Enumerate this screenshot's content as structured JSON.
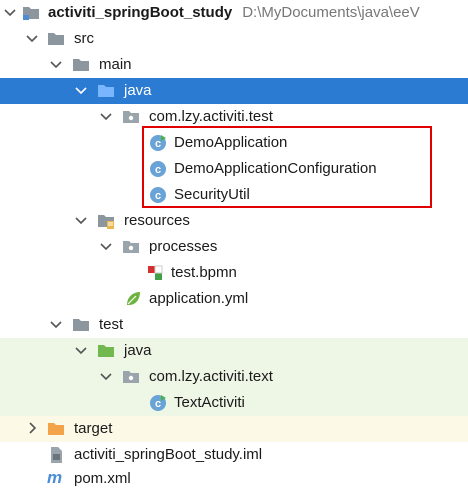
{
  "tree": {
    "root": {
      "name": "activiti_springBoot_study",
      "path": "D:\\MyDocuments\\java\\eeV"
    },
    "src": "src",
    "main": "main",
    "main_java": "java",
    "main_pkg": "com.lzy.activiti.test",
    "demo_app": "DemoApplication",
    "demo_config": "DemoApplicationConfiguration",
    "security_util": "SecurityUtil",
    "resources": "resources",
    "processes": "processes",
    "bpmn": "test.bpmn",
    "app_yml": "application.yml",
    "test": "test",
    "test_java": "java",
    "test_pkg": "com.lzy.activiti.text",
    "text_activiti": "TextActiviti",
    "target": "target",
    "iml": "activiti_springBoot_study.iml",
    "pom": "pom.xml"
  },
  "colors": {
    "selection": "#2b7bd2",
    "folder": "#8c969e",
    "source_folder": "#4b8ed6",
    "test_folder": "#71b94f",
    "target_folder": "#f3a34a",
    "class_icon": "#6aa3d6",
    "highlight_box": "#e00000"
  }
}
